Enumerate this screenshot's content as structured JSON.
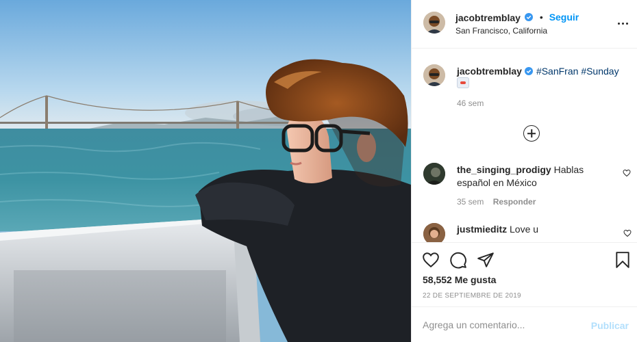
{
  "post": {
    "username": "jacobtremblay",
    "follow_label": "Seguir",
    "follow_separator": "•",
    "location": "San Francisco, California",
    "verified_icon": "verified-badge-icon",
    "more_icon": "more-options-icon",
    "accent_color": "#0095f6"
  },
  "caption": {
    "username": "jacobtremblay",
    "hashtags": [
      "#SanFran",
      "#Sunday"
    ],
    "emoji": "flag-emoji",
    "time": "46 sem"
  },
  "load_more_icon": "plus-circle-icon",
  "comments": [
    {
      "username": "the_singing_prodigy",
      "text": "Hablas español en México",
      "time": "35 sem",
      "reply_label": "Responder"
    },
    {
      "username": "justmieditz",
      "text": "Love u"
    }
  ],
  "actions": {
    "icons": [
      "heart-icon",
      "comment-icon",
      "share-icon",
      "bookmark-icon"
    ],
    "likes": "58,552 Me gusta",
    "date": "22 DE SEPTIEMBRE DE 2019"
  },
  "comment_box": {
    "placeholder": "Agrega un comentario...",
    "publish_label": "Publicar",
    "publish_color": "#b2dffc"
  }
}
